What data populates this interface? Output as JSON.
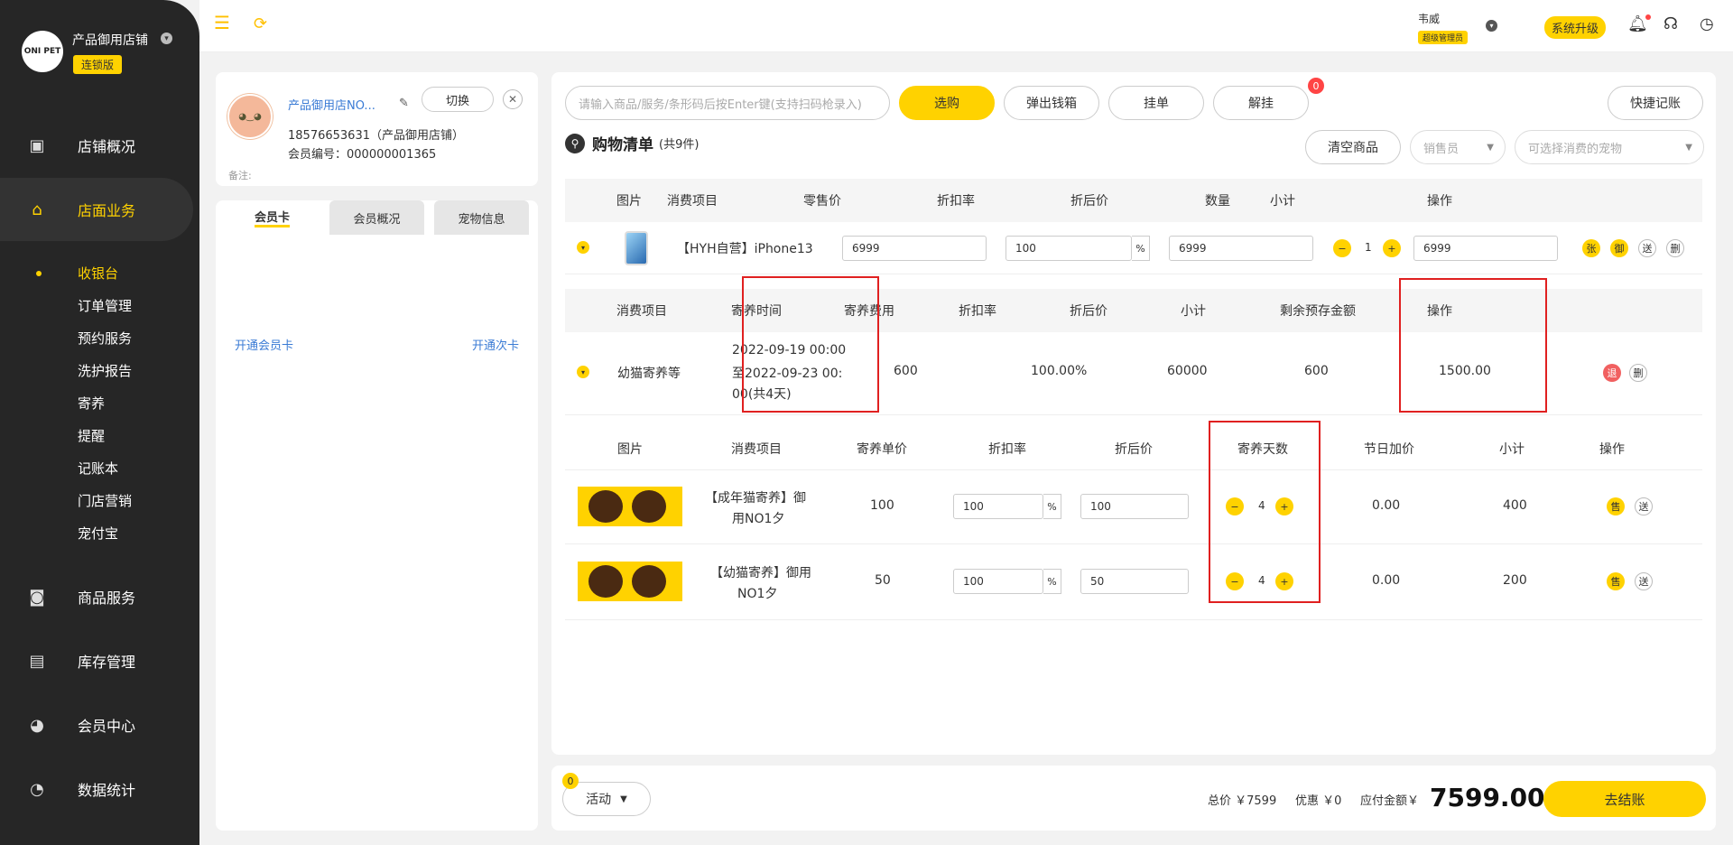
{
  "sidebar": {
    "store_name": "产品御用店铺",
    "edition": "连锁版",
    "logo_text": "ONI PET",
    "nav": [
      {
        "label": "店铺概况",
        "icon": "dashboard-icon"
      },
      {
        "label": "店面业务",
        "icon": "store-icon"
      },
      {
        "label": "商品服务",
        "icon": "goods-icon"
      },
      {
        "label": "库存管理",
        "icon": "inventory-icon"
      },
      {
        "label": "会员中心",
        "icon": "member-icon"
      },
      {
        "label": "数据统计",
        "icon": "stats-icon"
      }
    ],
    "sub": [
      "收银台",
      "订单管理",
      "预约服务",
      "洗护报告",
      "寄养",
      "提醒",
      "记账本",
      "门店营销",
      "宠付宝"
    ]
  },
  "topbar": {
    "user_name": "韦威",
    "user_role": "超级管理员",
    "upgrade_label": "系统升级"
  },
  "member": {
    "store_link": "产品御用店NO...",
    "switch_label": "切换",
    "close_glyph": "✕",
    "phone": "18576653631（产品御用店铺）",
    "member_no": "会员编号：000000001365",
    "remark_label": "备注:",
    "tabs": [
      "会员卡",
      "会员概况",
      "宠物信息"
    ],
    "open_card": "开通会员卡",
    "open_sub": "开通次卡"
  },
  "toolbar": {
    "search_placeholder": "请输入商品/服务/条形码后按Enter键(支持扫码枪录入)",
    "select_label": "选购",
    "cash_drawer_label": "弹出钱箱",
    "hold_label": "挂单",
    "unhold_label": "解挂",
    "unhold_badge": "0",
    "quick_label": "快捷记账"
  },
  "cart": {
    "title": "购物清单",
    "count": "(共9件)",
    "clear_label": "清空商品",
    "sales_placeholder": "销售员",
    "pet_placeholder": "可选择消费的宠物"
  },
  "goods_table": {
    "headers": [
      "图片",
      "消费项目",
      "零售价",
      "折扣率",
      "折后价",
      "数量",
      "小计",
      "操作"
    ],
    "row": {
      "name": "【HYH自营】iPhone13",
      "price": "6999",
      "discount": "100",
      "pct": "%",
      "after": "6999",
      "minus": "−",
      "qty": "1",
      "plus": "+",
      "subtotal": "6999",
      "ops": [
        "张",
        "御",
        "送",
        "删"
      ]
    }
  },
  "boarding_table": {
    "headers": [
      "消费项目",
      "寄养时间",
      "寄养费用",
      "折扣率",
      "折后价",
      "小计",
      "剩余预存金额",
      "操作"
    ],
    "row": {
      "name": "幼猫寄养等",
      "time_lines": [
        "2022-09-19 00:00",
        "至2022-09-23 00:",
        "00(共4天)"
      ],
      "fee": "600",
      "discount": "100.00%",
      "after": "60000",
      "subtotal": "600",
      "remaining": "1500.00",
      "ops": [
        "退",
        "删"
      ]
    }
  },
  "boarding_items_table": {
    "headers": [
      "图片",
      "消费项目",
      "寄养单价",
      "折扣率",
      "折后价",
      "寄养天数",
      "节日加价",
      "小计",
      "操作"
    ],
    "rows": [
      {
        "name_lines": [
          "【成年猫寄养】御",
          "用NO1夕"
        ],
        "unit": "100",
        "discount": "100",
        "pct": "%",
        "after": "100",
        "minus": "−",
        "days": "4",
        "plus": "+",
        "holiday": "0.00",
        "subtotal": "400",
        "ops": [
          "售",
          "送"
        ]
      },
      {
        "name_lines": [
          "【幼猫寄养】御用",
          "NO1夕"
        ],
        "unit": "50",
        "discount": "100",
        "pct": "%",
        "after": "50",
        "minus": "−",
        "days": "4",
        "plus": "+",
        "holiday": "0.00",
        "subtotal": "200",
        "ops": [
          "售",
          "送"
        ]
      }
    ]
  },
  "footer": {
    "activity_label": "活动",
    "activity_badge": "0",
    "total_text": "总价 ￥7599",
    "discount_text": "优惠 ￥0",
    "payable_label": "应付金额￥",
    "payable_amount": "7599.00",
    "checkout_label": "去结账"
  },
  "colors": {
    "accent": "#ffd200",
    "sidebar": "#262626",
    "link": "#3a7bd5",
    "highlight_box": "#e02020"
  }
}
